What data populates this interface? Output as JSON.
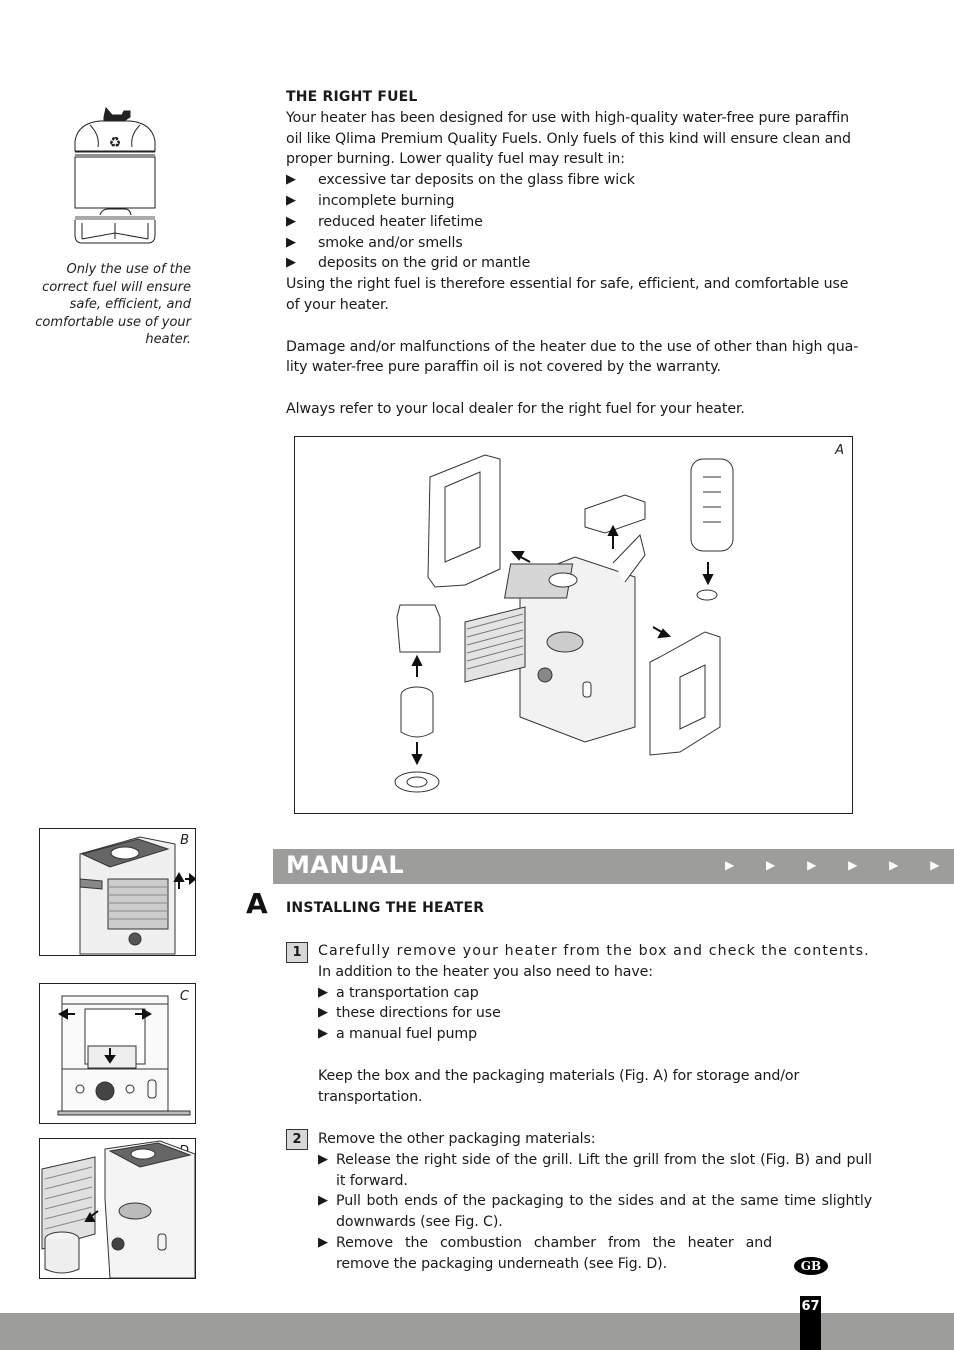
{
  "fuel_section": {
    "heading": "THE RIGHT FUEL",
    "intro_lines": [
      "Your heater has been designed for use with high-quality water-free pure paraffin",
      "oil like Qlima Premium Quality Fuels. Only fuels of this kind will ensure clean and",
      "proper burning. Lower quality fuel may result in:"
    ],
    "bullet_glyph": "▶",
    "bullets": [
      "excessive tar deposits on the glass fibre wick",
      "incomplete burning",
      "reduced heater lifetime",
      "smoke and/or smells",
      "deposits on the grid or mantle"
    ],
    "conclusion_lines": [
      "Using the right fuel is therefore essential for safe, efficient, and comfortable use",
      "of your heater."
    ],
    "warranty_lines": [
      "Damage and/or malfunctions of the heater due to the use of other than high qua-",
      "lity water-free pure paraffin oil is not covered by the warranty."
    ],
    "dealer_note": "Always refer to your local dealer for the right fuel for your heater."
  },
  "sidebar": {
    "fuel_caption_lines": [
      "Only the use of the",
      "correct fuel will ensure",
      "safe, efficient, and",
      "comfortable use of your",
      "heater."
    ]
  },
  "figures": {
    "a_label": "A",
    "b_label": "B",
    "c_label": "C",
    "d_label": "D"
  },
  "manual_banner": {
    "title": "MANUAL",
    "arrows": "▶ ▶ ▶ ▶ ▶ ▶"
  },
  "installing": {
    "section_letter": "A",
    "heading": "INSTALLING THE HEATER",
    "steps": [
      {
        "number": "1",
        "first_line": "Carefully remove your heater from the box and check the contents.",
        "second_line": "In addition to the heater you also need to have:",
        "items": [
          "a transportation cap",
          "these directions for use",
          "a manual fuel pump"
        ],
        "note_lines": [
          "Keep the box and the packaging materials (Fig. A) for storage and/or",
          "transportation."
        ]
      },
      {
        "number": "2",
        "first_line": "Remove the other packaging materials:",
        "items": [
          "Release the right side of the grill. Lift the grill from the slot (Fig. B) and pull it forward.",
          "Pull both ends of the packaging to the sides and at the same time slightly downwards (see Fig. C).",
          "Remove the combustion chamber from the heater and remove the packaging underneath (see Fig. D)."
        ]
      }
    ]
  },
  "footer": {
    "language_badge": "GB",
    "page_number": "67"
  }
}
